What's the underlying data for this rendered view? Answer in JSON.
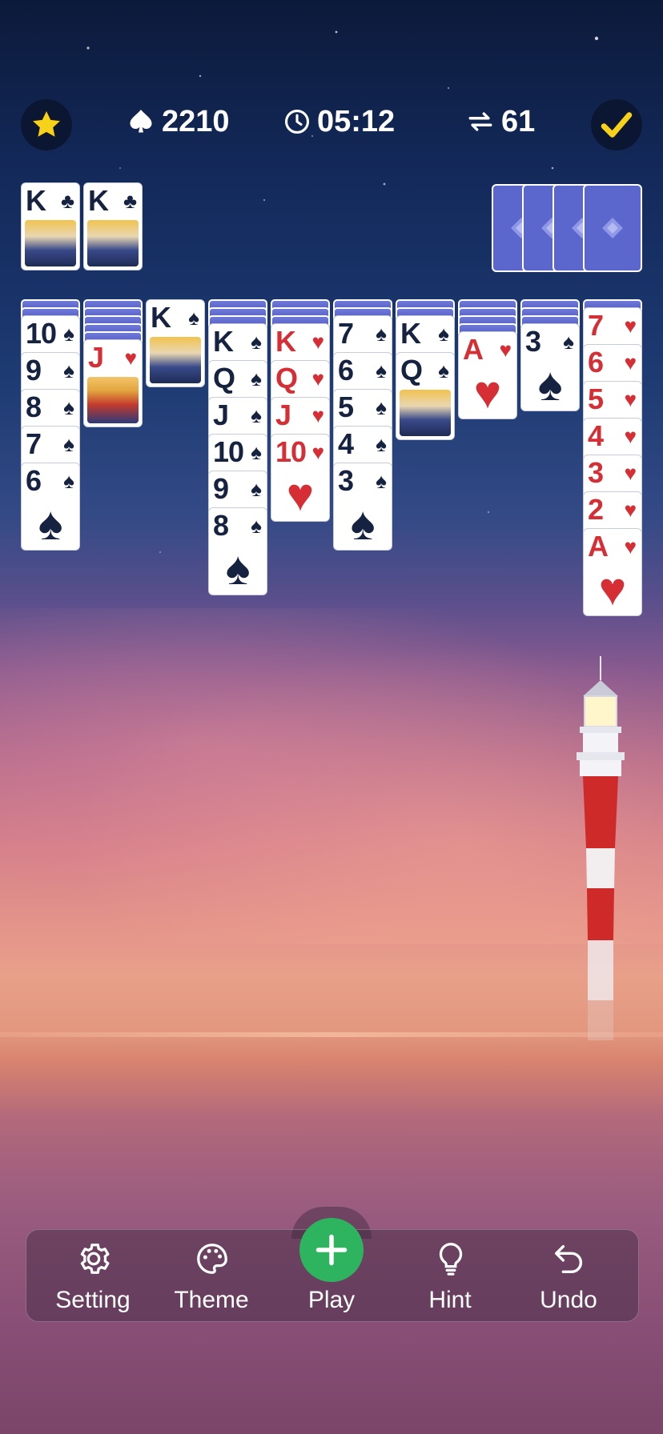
{
  "topbar": {
    "score": "2210",
    "time": "05:12",
    "moves": "61",
    "icons": [
      "star-icon",
      "spade-icon",
      "clock-icon",
      "swap-arrows-icon",
      "check-icon"
    ]
  },
  "foundation": [
    {
      "rank": "K",
      "suit": "♣"
    },
    {
      "rank": "K",
      "suit": "♣"
    }
  ],
  "stock": {
    "count": 4
  },
  "tableau": [
    {
      "hidden": 2,
      "cards": [
        {
          "rank": "10",
          "suit": "♠",
          "color": "black"
        },
        {
          "rank": "9",
          "suit": "♠",
          "color": "black"
        },
        {
          "rank": "8",
          "suit": "♠",
          "color": "black"
        },
        {
          "rank": "7",
          "suit": "♠",
          "color": "black"
        },
        {
          "rank": "6",
          "suit": "♠",
          "color": "black"
        }
      ]
    },
    {
      "hidden": 5,
      "cards": [
        {
          "rank": "J",
          "suit": "♥",
          "color": "red"
        }
      ]
    },
    {
      "hidden": 0,
      "cards": [
        {
          "rank": "K",
          "suit": "♠",
          "color": "black"
        }
      ]
    },
    {
      "hidden": 3,
      "cards": [
        {
          "rank": "K",
          "suit": "♠",
          "color": "black"
        },
        {
          "rank": "Q",
          "suit": "♠",
          "color": "black"
        },
        {
          "rank": "J",
          "suit": "♠",
          "color": "black"
        },
        {
          "rank": "10",
          "suit": "♠",
          "color": "black"
        },
        {
          "rank": "9",
          "suit": "♠",
          "color": "black"
        },
        {
          "rank": "8",
          "suit": "♠",
          "color": "black"
        }
      ]
    },
    {
      "hidden": 3,
      "cards": [
        {
          "rank": "K",
          "suit": "♥",
          "color": "red"
        },
        {
          "rank": "Q",
          "suit": "♥",
          "color": "red"
        },
        {
          "rank": "J",
          "suit": "♥",
          "color": "red"
        },
        {
          "rank": "10",
          "suit": "♥",
          "color": "red"
        }
      ]
    },
    {
      "hidden": 2,
      "cards": [
        {
          "rank": "7",
          "suit": "♠",
          "color": "black"
        },
        {
          "rank": "6",
          "suit": "♠",
          "color": "black"
        },
        {
          "rank": "5",
          "suit": "♠",
          "color": "black"
        },
        {
          "rank": "4",
          "suit": "♠",
          "color": "black"
        },
        {
          "rank": "3",
          "suit": "♠",
          "color": "black"
        }
      ]
    },
    {
      "hidden": 2,
      "cards": [
        {
          "rank": "K",
          "suit": "♠",
          "color": "black"
        },
        {
          "rank": "Q",
          "suit": "♠",
          "color": "black"
        }
      ]
    },
    {
      "hidden": 4,
      "cards": [
        {
          "rank": "A",
          "suit": "♥",
          "color": "red"
        }
      ]
    },
    {
      "hidden": 3,
      "cards": [
        {
          "rank": "3",
          "suit": "♠",
          "color": "black"
        }
      ]
    },
    {
      "hidden": 1,
      "cards": [
        {
          "rank": "7",
          "suit": "♥",
          "color": "red"
        },
        {
          "rank": "6",
          "suit": "♥",
          "color": "red"
        },
        {
          "rank": "5",
          "suit": "♥",
          "color": "red"
        },
        {
          "rank": "4",
          "suit": "♥",
          "color": "red"
        },
        {
          "rank": "3",
          "suit": "♥",
          "color": "red"
        },
        {
          "rank": "2",
          "suit": "♥",
          "color": "red"
        },
        {
          "rank": "A",
          "suit": "♥",
          "color": "red"
        }
      ]
    }
  ],
  "toolbar": {
    "setting_label": "Setting",
    "theme_label": "Theme",
    "play_label": "Play",
    "hint_label": "Hint",
    "undo_label": "Undo"
  },
  "colors": {
    "play_button": "#2eb45e",
    "card_back": "#5b67cc",
    "red_suit": "#d62e35",
    "black_suit": "#152240",
    "star": "#f7d21a"
  }
}
